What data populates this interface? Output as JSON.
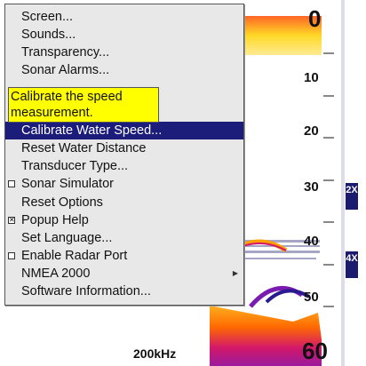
{
  "menu": {
    "items": [
      {
        "label": "Screen...",
        "checkbox": null,
        "selected": false,
        "submenu": false
      },
      {
        "label": "Sounds...",
        "checkbox": null,
        "selected": false,
        "submenu": false
      },
      {
        "label": "Transparency...",
        "checkbox": null,
        "selected": false,
        "submenu": false
      },
      {
        "label": "Sonar Alarms...",
        "checkbox": null,
        "selected": false,
        "submenu": false
      },
      {
        "label": "Calibrate Water Speed...",
        "checkbox": null,
        "selected": true,
        "submenu": false
      },
      {
        "label": "Reset Water Distance",
        "checkbox": null,
        "selected": false,
        "submenu": false
      },
      {
        "label": "Transducer Type...",
        "checkbox": null,
        "selected": false,
        "submenu": false
      },
      {
        "label": "Sonar Simulator",
        "checkbox": "unchecked",
        "selected": false,
        "submenu": false
      },
      {
        "label": "Reset Options",
        "checkbox": null,
        "selected": false,
        "submenu": false
      },
      {
        "label": "Popup Help",
        "checkbox": "checked",
        "selected": false,
        "submenu": false
      },
      {
        "label": "Set Language...",
        "checkbox": null,
        "selected": false,
        "submenu": false
      },
      {
        "label": "Enable Radar Port",
        "checkbox": "unchecked",
        "selected": false,
        "submenu": false
      },
      {
        "label": "NMEA 2000",
        "checkbox": null,
        "selected": false,
        "submenu": true
      },
      {
        "label": "Software Information...",
        "checkbox": null,
        "selected": false,
        "submenu": false
      }
    ],
    "help_text_line1": "Calibrate the speed",
    "help_text_line2": "measurement.",
    "check_mark": "✕",
    "submenu_arrow": "▶"
  },
  "sonar": {
    "depth_top": "0",
    "depth_10": "10",
    "depth_20": "20",
    "depth_30": "30",
    "depth_40": "40",
    "depth_50": "50",
    "depth_bottom": "60",
    "zoom_2x": "2X",
    "zoom_4x": "4X",
    "frequency": "200kHz"
  },
  "colors": {
    "selected_bg": "#1c1c7a",
    "help_bg": "#ffff00",
    "menu_bg": "#e8e8e8",
    "zoom_bar": "#1a1a6e"
  }
}
